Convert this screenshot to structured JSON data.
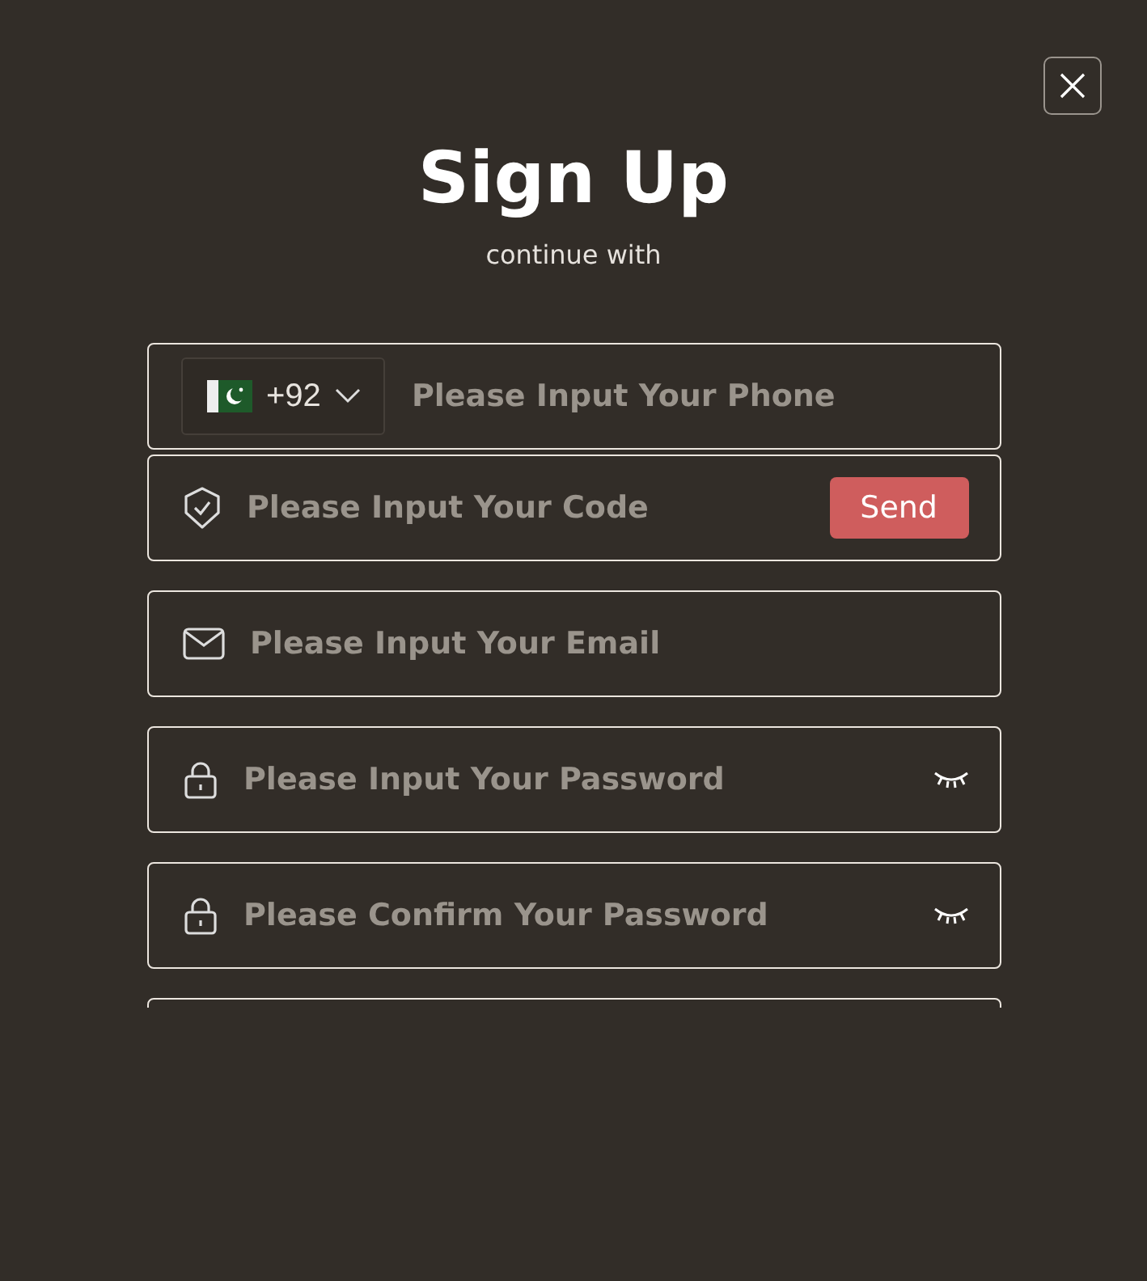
{
  "dialog": {
    "title": "Sign Up",
    "subtitle": "continue with"
  },
  "fields": [
    {
      "kind": "phone",
      "country_code": "+92",
      "placeholder": "Please Input Your Phone"
    },
    {
      "kind": "code",
      "placeholder": "Please Input Your Code",
      "button": "Send"
    },
    {
      "kind": "email",
      "placeholder": "Please Input Your Email"
    },
    {
      "kind": "password",
      "placeholder": "Please Input Your Password",
      "visible": false
    },
    {
      "kind": "password",
      "placeholder": "Please Confirm Your Password",
      "visible": false
    },
    {
      "kind": "partial"
    }
  ]
}
